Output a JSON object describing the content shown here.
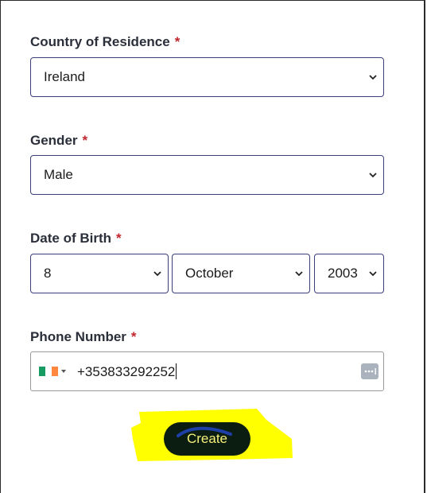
{
  "form": {
    "country": {
      "label": "Country of Residence",
      "required_mark": "*",
      "value": "Ireland"
    },
    "gender": {
      "label": "Gender",
      "required_mark": "*",
      "value": "Male"
    },
    "dob": {
      "label": "Date of Birth",
      "required_mark": "*",
      "day": "8",
      "month": "October",
      "year": "2003"
    },
    "phone": {
      "label": "Phone Number",
      "required_mark": "*",
      "value": "+353833292252",
      "country_flag": "ireland-flag-icon"
    },
    "submit": {
      "label": "Create"
    }
  },
  "colors": {
    "required": "#c0262d",
    "select_border": "#3b3f7a",
    "button_bg": "#0b1d10",
    "button_text": "#f5f07a",
    "highlight": "#ffff00"
  }
}
